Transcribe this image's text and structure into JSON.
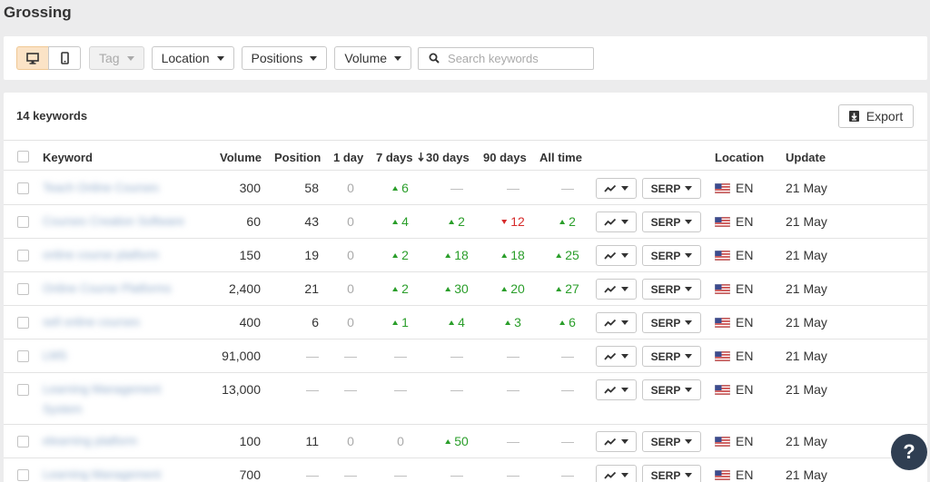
{
  "page": {
    "title": "Grossing"
  },
  "toolbar": {
    "tag_label": "Tag",
    "location_label": "Location",
    "positions_label": "Positions",
    "volume_label": "Volume",
    "search_placeholder": "Search keywords"
  },
  "summary": {
    "count_label": "14 keywords",
    "export_label": "Export"
  },
  "columns": {
    "keyword": "Keyword",
    "volume": "Volume",
    "position": "Position",
    "day1": "1 day",
    "day7": "7 days",
    "day30": "30 days",
    "day90": "90 days",
    "alltime": "All time",
    "location": "Location",
    "update": "Update"
  },
  "serp_label": "SERP",
  "rows": [
    {
      "keyword": "Teach Online Courses",
      "volume": "300",
      "position": "58",
      "d1": "0",
      "d7": {
        "v": "6",
        "dir": "up"
      },
      "d30": {
        "v": "—",
        "dir": "none"
      },
      "d90": {
        "v": "—",
        "dir": "none"
      },
      "all": {
        "v": "—",
        "dir": "none"
      },
      "lang": "EN",
      "update": "21 May"
    },
    {
      "keyword": "Courses Creation Software",
      "volume": "60",
      "position": "43",
      "d1": "0",
      "d7": {
        "v": "4",
        "dir": "up"
      },
      "d30": {
        "v": "2",
        "dir": "up"
      },
      "d90": {
        "v": "12",
        "dir": "down"
      },
      "all": {
        "v": "2",
        "dir": "up"
      },
      "lang": "EN",
      "update": "21 May"
    },
    {
      "keyword": "online course platform",
      "volume": "150",
      "position": "19",
      "d1": "0",
      "d7": {
        "v": "2",
        "dir": "up"
      },
      "d30": {
        "v": "18",
        "dir": "up"
      },
      "d90": {
        "v": "18",
        "dir": "up"
      },
      "all": {
        "v": "25",
        "dir": "up"
      },
      "lang": "EN",
      "update": "21 May"
    },
    {
      "keyword": "Online Course Platforms",
      "volume": "2,400",
      "position": "21",
      "d1": "0",
      "d7": {
        "v": "2",
        "dir": "up"
      },
      "d30": {
        "v": "30",
        "dir": "up"
      },
      "d90": {
        "v": "20",
        "dir": "up"
      },
      "all": {
        "v": "27",
        "dir": "up"
      },
      "lang": "EN",
      "update": "21 May"
    },
    {
      "keyword": "sell online courses",
      "volume": "400",
      "position": "6",
      "d1": "0",
      "d7": {
        "v": "1",
        "dir": "up"
      },
      "d30": {
        "v": "4",
        "dir": "up"
      },
      "d90": {
        "v": "3",
        "dir": "up"
      },
      "all": {
        "v": "6",
        "dir": "up"
      },
      "lang": "EN",
      "update": "21 May"
    },
    {
      "keyword": "LMS",
      "volume": "91,000",
      "position": "—",
      "d1": "—",
      "d7": {
        "v": "—",
        "dir": "none"
      },
      "d30": {
        "v": "—",
        "dir": "none"
      },
      "d90": {
        "v": "—",
        "dir": "none"
      },
      "all": {
        "v": "—",
        "dir": "none"
      },
      "lang": "EN",
      "update": "21 May"
    },
    {
      "keyword": "Learning Management",
      "keyword2": "System",
      "volume": "13,000",
      "position": "—",
      "d1": "—",
      "d7": {
        "v": "—",
        "dir": "none"
      },
      "d30": {
        "v": "—",
        "dir": "none"
      },
      "d90": {
        "v": "—",
        "dir": "none"
      },
      "all": {
        "v": "—",
        "dir": "none"
      },
      "lang": "EN",
      "update": "21 May"
    },
    {
      "keyword": "elearning platform",
      "volume": "100",
      "position": "11",
      "d1": "0",
      "d7": {
        "v": "0",
        "dir": "muted"
      },
      "d30": {
        "v": "50",
        "dir": "up"
      },
      "d90": {
        "v": "—",
        "dir": "none"
      },
      "all": {
        "v": "—",
        "dir": "none"
      },
      "lang": "EN",
      "update": "21 May"
    },
    {
      "keyword": "Learning Management",
      "volume": "700",
      "position": "—",
      "d1": "—",
      "d7": {
        "v": "—",
        "dir": "none"
      },
      "d30": {
        "v": "—",
        "dir": "none"
      },
      "d90": {
        "v": "—",
        "dir": "none"
      },
      "all": {
        "v": "—",
        "dir": "none"
      },
      "lang": "EN",
      "update": "21 May"
    }
  ],
  "help": {
    "label": "?"
  },
  "colors": {
    "accent_active": "#fbe3c6",
    "up": "#2a9e2a",
    "down": "#d62b2b",
    "help_bg": "#2f3e52"
  }
}
